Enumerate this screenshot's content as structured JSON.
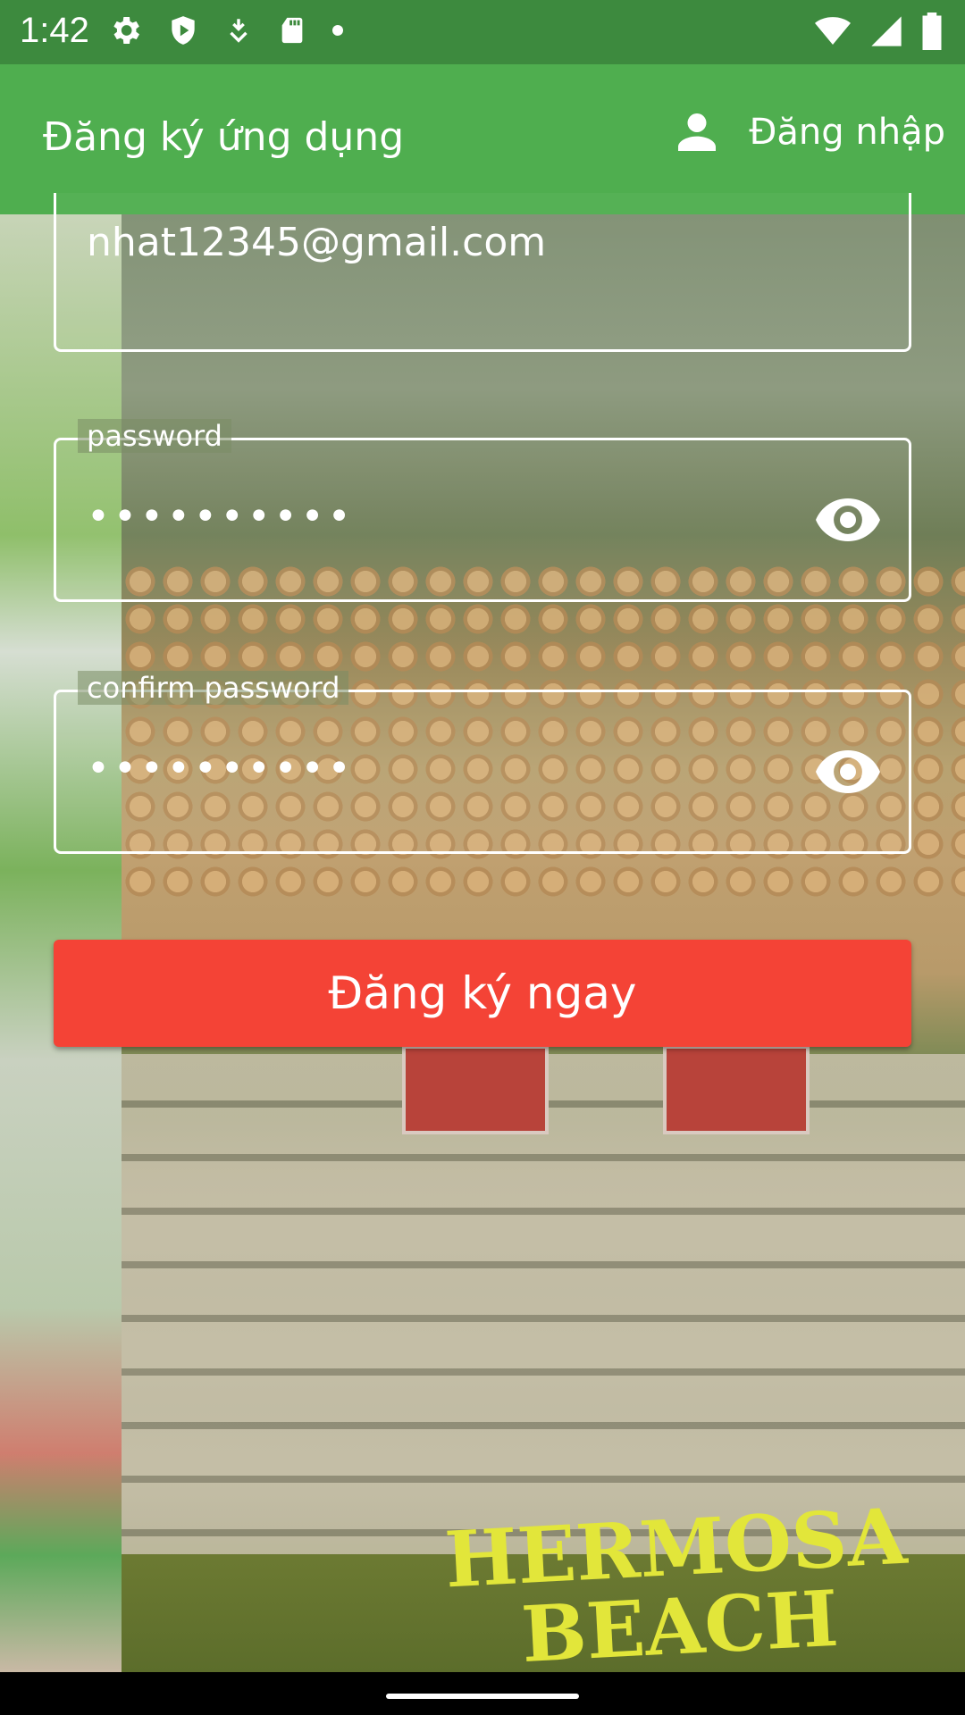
{
  "status_bar": {
    "time": "1:42",
    "icons": [
      "gear-icon",
      "play-shield-icon",
      "download-arrow-icon",
      "sd-card-icon",
      "dot-icon",
      "wifi-icon",
      "signal-icon",
      "battery-icon"
    ]
  },
  "app_bar": {
    "title": "Đăng ký ứng dụng",
    "login_label": "Đăng nhập",
    "login_icon": "person-icon",
    "color": "#4fae4f"
  },
  "background": {
    "mat_text_line1": "HERMOSA",
    "mat_text_line2": "BEACH"
  },
  "form": {
    "email_value": "nhat12345@gmail.com",
    "password_label": "password",
    "password_value": "••••••••••",
    "confirm_label": "confirm password",
    "confirm_value": "••••••••••",
    "register_label": "Đăng ký ngay",
    "register_color": "#f44336"
  }
}
